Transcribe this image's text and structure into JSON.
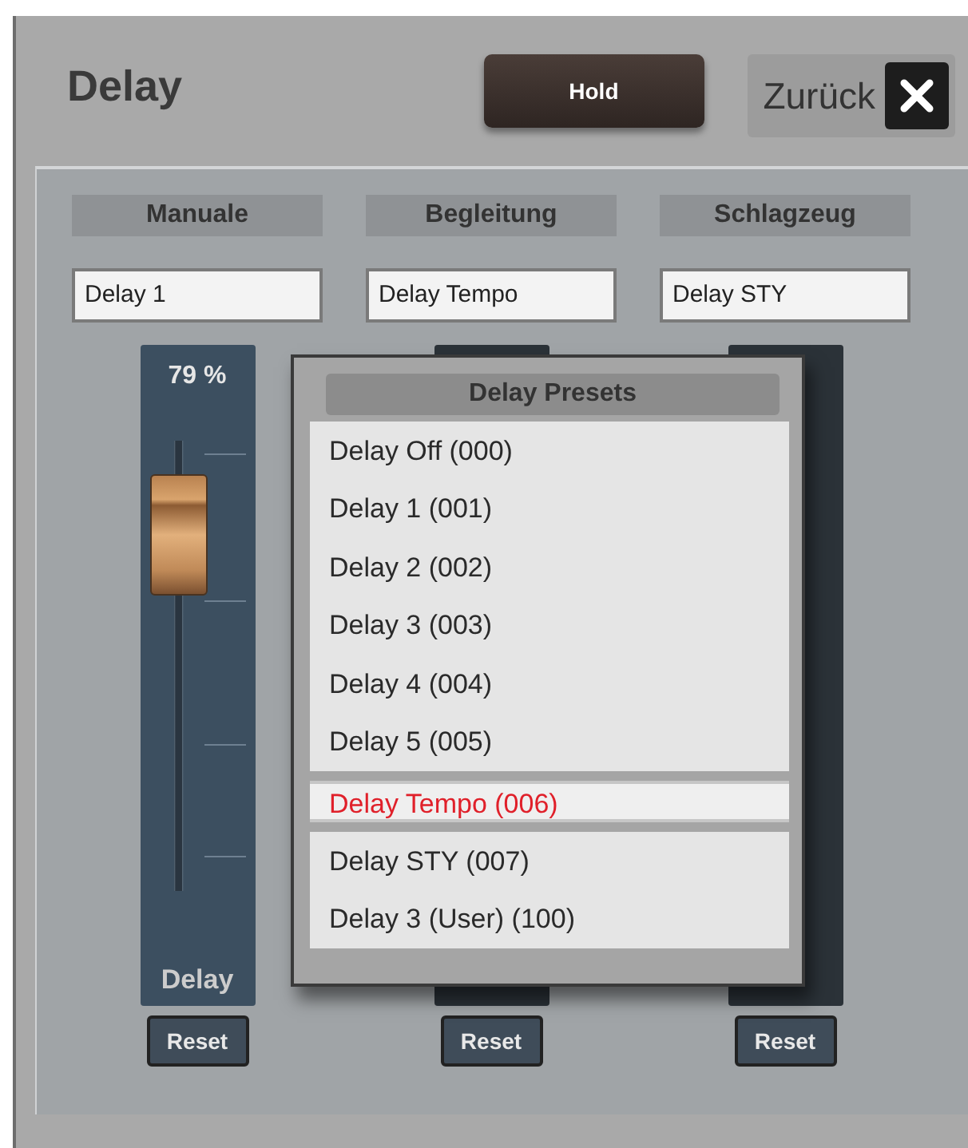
{
  "dialog": {
    "title": "Delay",
    "hold_button": "Hold",
    "back_button": "Zurück"
  },
  "channels": [
    {
      "label": "Manuale",
      "preset": "Delay 1",
      "reading": "79 %",
      "level": 0.79,
      "fader_label": "Delay",
      "reset": "Reset"
    },
    {
      "label": "Begleitung",
      "preset": "Delay Tempo",
      "reset": "Reset"
    },
    {
      "label": "Schlagzeug",
      "preset": "Delay STY",
      "reset": "Reset"
    }
  ],
  "popup": {
    "title": "Delay Presets",
    "items": [
      {
        "label": "Delay Off (000)",
        "selected": false
      },
      {
        "label": "Delay 1 (001)",
        "selected": false
      },
      {
        "label": "Delay 2 (002)",
        "selected": false
      },
      {
        "label": "Delay 3 (003)",
        "selected": false
      },
      {
        "label": "Delay 4 (004)",
        "selected": false
      },
      {
        "label": "Delay 5 (005)",
        "selected": false
      },
      {
        "label": "Delay Tempo (006)",
        "selected": true
      },
      {
        "label": "Delay STY (007)",
        "selected": false
      },
      {
        "label": "Delay 3 (User) (100)",
        "selected": false
      }
    ]
  }
}
